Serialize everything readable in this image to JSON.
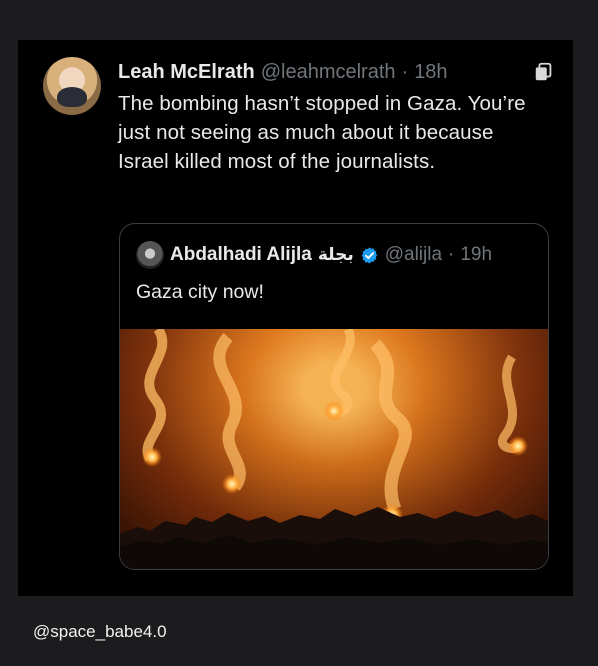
{
  "tweet": {
    "author_name": "Leah McElrath",
    "author_handle": "@leahmcelrath",
    "separator": "·",
    "time": "18h",
    "text": "The bombing hasn’t stopped in Gaza. You’re just not seeing as much about it because Israel killed most of the journalists.",
    "icons": {
      "bookmark": "bookmark-icon"
    }
  },
  "quote_tweet": {
    "author_name": "Abdalhadi Alijla",
    "author_name_arabic": "بجلة",
    "verified_color": "#1d9bf0",
    "author_handle": "@alijla",
    "separator": "·",
    "time": "19h",
    "text": "Gaza city now!"
  },
  "footer": {
    "handle": "@space_babe4.0"
  },
  "colors": {
    "background": "#1c1c1e",
    "card": "#000000",
    "text_primary": "#e7e9ea",
    "text_secondary": "#71767b"
  }
}
